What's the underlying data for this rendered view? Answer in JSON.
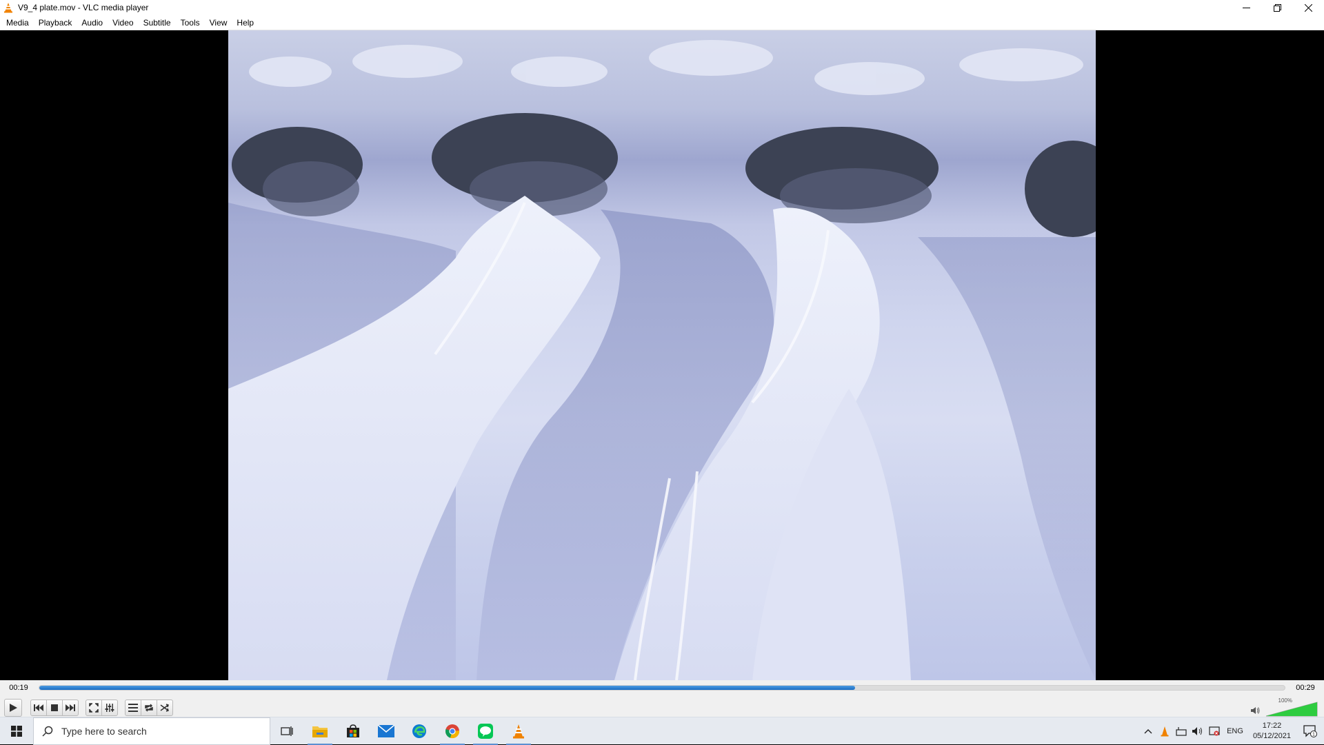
{
  "window": {
    "title": "V9_4 plate.mov - VLC media player",
    "app_icon": "vlc-cone-icon",
    "controls": [
      "minimize-icon",
      "restore-icon",
      "close-icon"
    ]
  },
  "menu": {
    "items": [
      "Media",
      "Playback",
      "Audio",
      "Video",
      "Subtitle",
      "Tools",
      "View",
      "Help"
    ]
  },
  "video": {
    "content": "snow-drifts-scene"
  },
  "seek": {
    "elapsed": "00:19",
    "total": "00:29",
    "progress_fraction": 0.655
  },
  "controls": {
    "buttons": [
      "play-icon",
      "previous-icon",
      "stop-icon",
      "next-icon",
      "fullscreen-icon",
      "extended-settings-icon",
      "playlist-icon",
      "loop-icon",
      "shuffle-icon"
    ],
    "volume_label": "100%",
    "volume_fraction": 1.0
  },
  "taskbar": {
    "search_placeholder": "Type here to search",
    "pinned": [
      "task-view-icon",
      "file-explorer-icon",
      "store-icon",
      "mail-icon",
      "edge-icon",
      "chrome-icon",
      "line-icon",
      "vlc-icon"
    ],
    "tray_lang": "ENG",
    "clock_time": "17:22",
    "clock_date": "05/12/2021",
    "notification_count": "1"
  },
  "colors": {
    "seek_fill": "#1a6cc4",
    "volume_fill": "#2ecc40",
    "vlc_orange": "#f08200"
  }
}
